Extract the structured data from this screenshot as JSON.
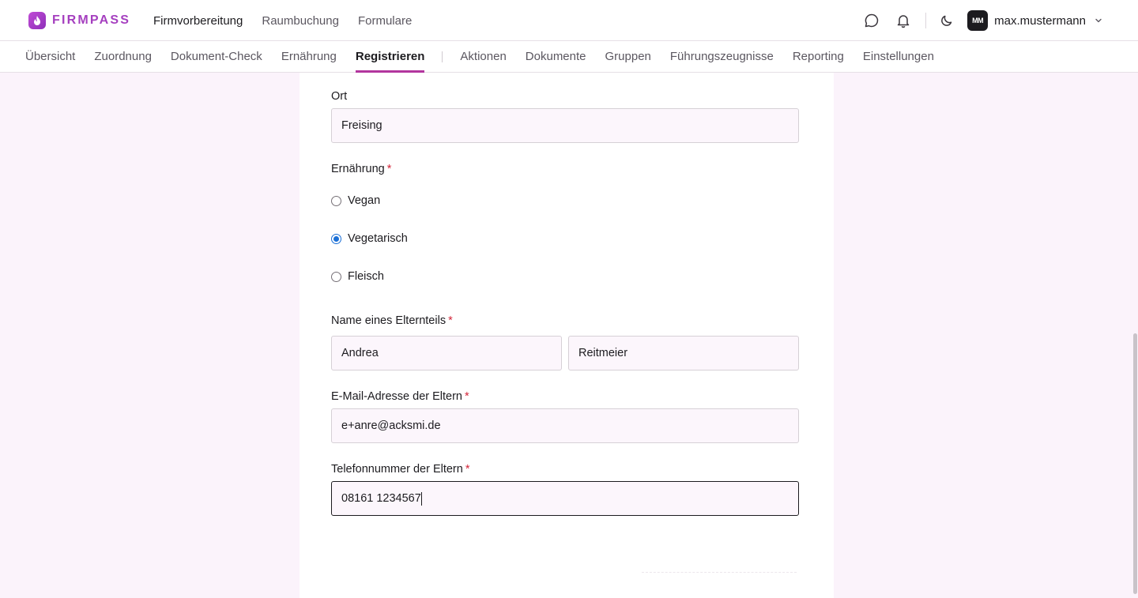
{
  "app": {
    "logo_text": "FIRMPASS"
  },
  "main_nav": [
    {
      "label": "Firmvorbereitung",
      "active": true
    },
    {
      "label": "Raumbuchung",
      "active": false
    },
    {
      "label": "Formulare",
      "active": false
    }
  ],
  "user": {
    "initials": "MM",
    "name": "max.mustermann"
  },
  "sub_nav": {
    "group1": [
      "Übersicht",
      "Zuordnung",
      "Dokument-Check",
      "Ernährung",
      "Registrieren"
    ],
    "group2": [
      "Aktionen",
      "Dokumente",
      "Gruppen",
      "Führungszeugnisse",
      "Reporting",
      "Einstellungen"
    ],
    "active": "Registrieren"
  },
  "form": {
    "ort": {
      "label": "Ort",
      "value": "Freising"
    },
    "ernaehrung": {
      "label": "Ernährung",
      "required_mark": "*",
      "options": [
        "Vegan",
        "Vegetarisch",
        "Fleisch"
      ],
      "selected": "Vegetarisch"
    },
    "elternteil": {
      "label": "Name eines Elternteils",
      "required_mark": "*",
      "first": "Andrea",
      "last": "Reitmeier"
    },
    "email": {
      "label": "E-Mail-Adresse der Eltern",
      "required_mark": "*",
      "value": "e+anre@acksmi.de"
    },
    "telefon": {
      "label": "Telefonnummer der Eltern",
      "required_mark": "*",
      "value": "08161 1234567"
    }
  },
  "colors": {
    "accent": "#b2359e",
    "brand": "#a53fbf",
    "radio_checked": "#1a6fd6",
    "required": "#d3263a"
  }
}
